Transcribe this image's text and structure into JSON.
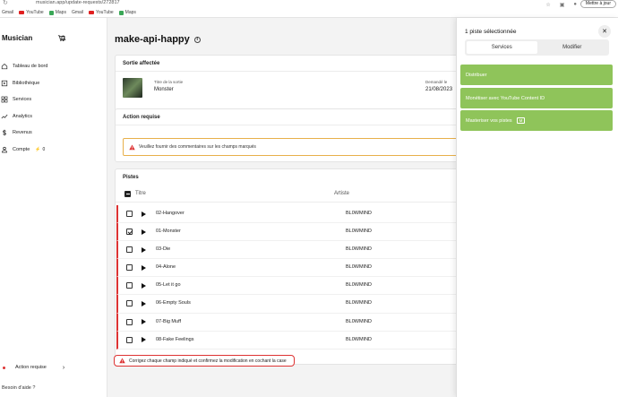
{
  "browser": {
    "url": "musician.app/update-requests/272817",
    "bookmarks": [
      "Gmail",
      "YouTube",
      "Maps",
      "Gmail",
      "YouTube",
      "Maps"
    ],
    "update_button": "Mettre à jour"
  },
  "sidebar": {
    "logo": "Musician",
    "nav": [
      {
        "label": "Tableau de bord",
        "icon": "home-icon"
      },
      {
        "label": "Bibliothèque",
        "icon": "library-icon"
      },
      {
        "label": "Services",
        "icon": "services-icon"
      },
      {
        "label": "Analytics",
        "icon": "analytics-icon"
      },
      {
        "label": "Revenus",
        "icon": "dollar-icon"
      },
      {
        "label": "Compte",
        "icon": "account-icon",
        "badge": "0"
      }
    ],
    "action_required": "Action requise",
    "help": "Besoin d'aide ?"
  },
  "main": {
    "title": "make-api-happy",
    "release": {
      "heading": "Sortie affectée",
      "title_label": "Titre de la sortie",
      "title_value": "Monster",
      "requested_label": "Demandé le",
      "requested_value": "21/08/2023"
    },
    "action": {
      "heading": "Action requise",
      "warning": "Veuillez fournir des commentaires sur les champs marqués"
    },
    "tracks": {
      "heading": "Pistes",
      "col_title": "Titre",
      "col_artist": "Artiste",
      "rows": [
        {
          "title": "02-Hangover",
          "artist": "BL0WMIND",
          "checked": false
        },
        {
          "title": "01-Monster",
          "artist": "BL0WMIND",
          "checked": true
        },
        {
          "title": "03-Die",
          "artist": "BL0WMIND",
          "checked": false
        },
        {
          "title": "04-Alone",
          "artist": "BL0WMIND",
          "checked": false
        },
        {
          "title": "05-Let it go",
          "artist": "BL0WMIND",
          "checked": false
        },
        {
          "title": "06-Empty Souls",
          "artist": "BL0WMIND",
          "checked": false
        },
        {
          "title": "07-Big Muff",
          "artist": "BL0WMIND",
          "checked": false
        },
        {
          "title": "08-Fake Feelings",
          "artist": "BL0WMIND",
          "checked": false
        }
      ]
    },
    "bottom_alert": "Corrigez chaque champ indiqué et confirmez la modification en cochant la case"
  },
  "panel": {
    "title": "1 piste sélectionnée",
    "tabs": [
      "Services",
      "Modifier"
    ],
    "active_tab": "Services",
    "buttons": [
      "Distribuer",
      "Monétiser avec YouTube Content ID",
      "Masteriser vos pistes"
    ],
    "master_badge": "M",
    "accent": "#8fc45a"
  }
}
